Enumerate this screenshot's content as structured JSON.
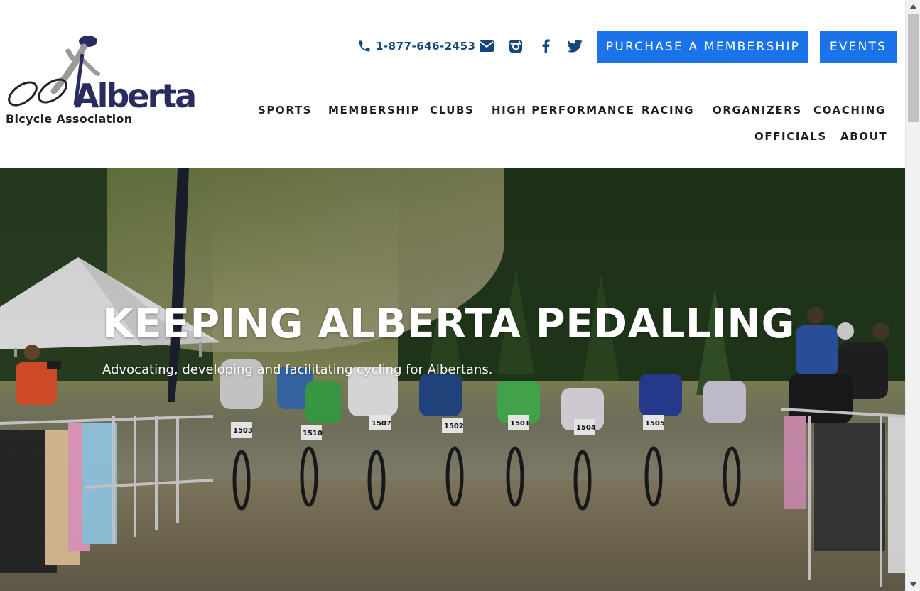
{
  "header": {
    "logo": {
      "wordmark": "Alberta",
      "subtitle": "Bicycle Association"
    },
    "contact": {
      "phone": "1-877-646-2453",
      "icons": [
        "phone-icon",
        "email-icon",
        "instagram-icon",
        "facebook-icon",
        "twitter-icon"
      ]
    },
    "buttons": {
      "membership": "PURCHASE A MEMBERSHIP",
      "events": "EVENTS"
    },
    "nav": [
      "SPORTS",
      "MEMBERSHIP",
      "CLUBS",
      "HIGH PERFORMANCE",
      "RACING",
      "ORGANIZERS",
      "COACHING",
      "OFFICIALS",
      "ABOUT"
    ]
  },
  "hero": {
    "title": "KEEPING ALBERTA PEDALLING",
    "subtitle": "Advocating, developing and facilitating cycling for Albertans.",
    "bib_numbers": [
      "1503",
      "1510",
      "1507",
      "1502",
      "1501",
      "1504",
      "1505"
    ]
  },
  "colors": {
    "accent": "#1a73e8",
    "brand_navy": "#16477a",
    "logo_navy": "#2a2b5e"
  }
}
